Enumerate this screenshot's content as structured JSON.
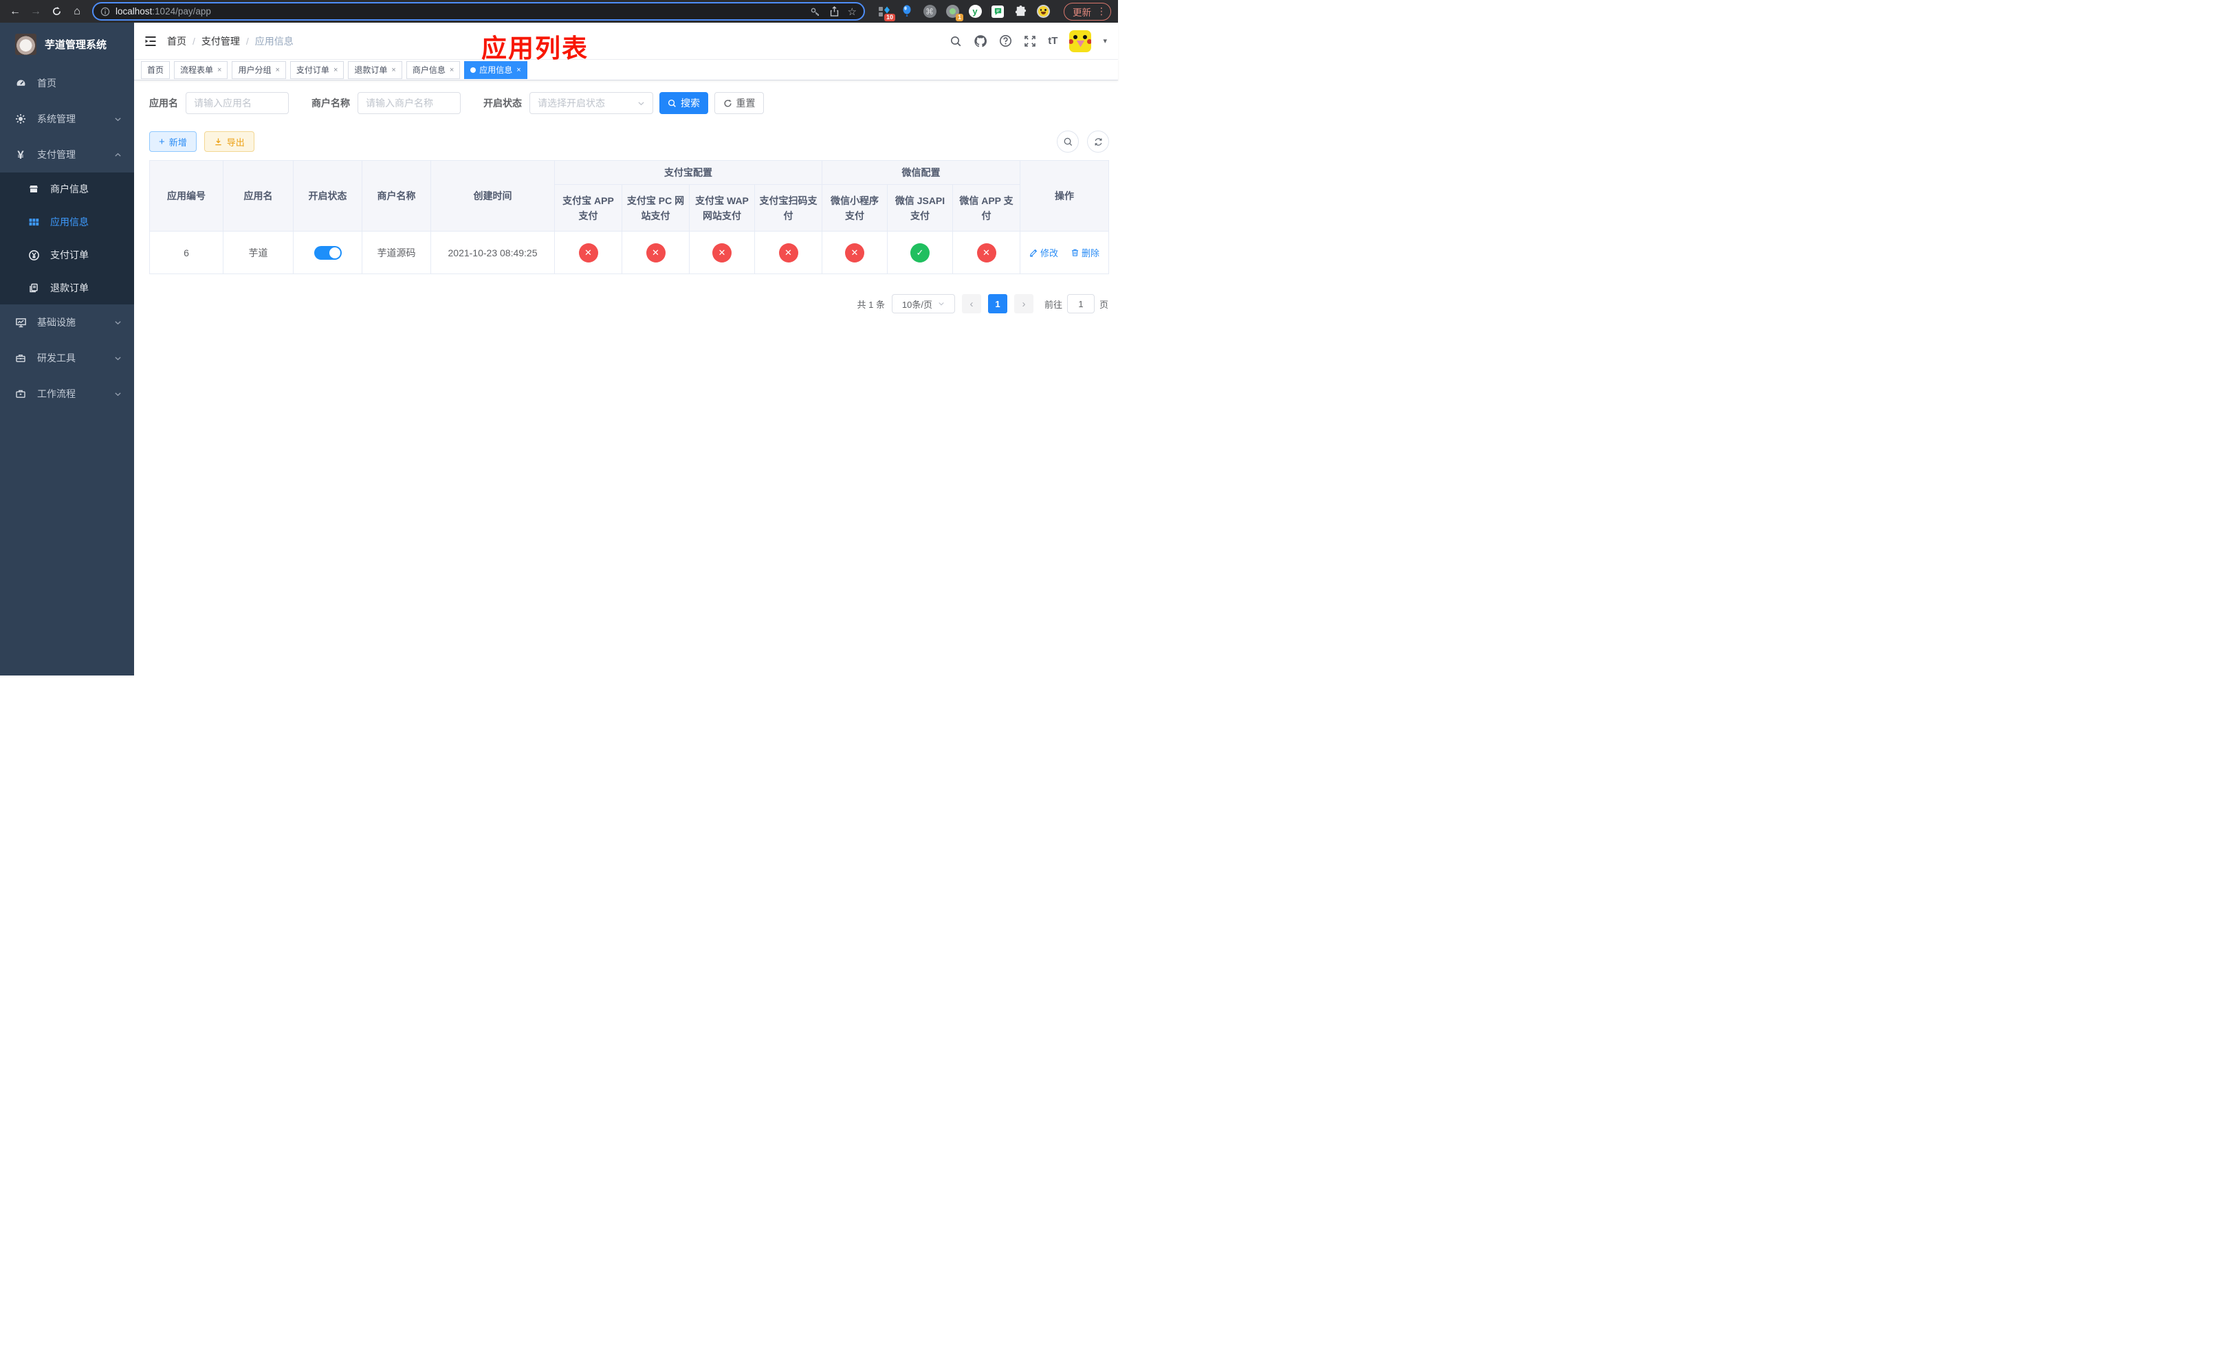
{
  "browser": {
    "url_host": "localhost",
    "url_path": ":1024/pay/app",
    "update_button": "更新",
    "extension_badge_1": "10",
    "extension_badge_2": "1"
  },
  "sidebar": {
    "title": "芋道管理系统",
    "items": [
      {
        "label": "首页"
      },
      {
        "label": "系统管理"
      },
      {
        "label": "支付管理"
      },
      {
        "label": "基础设施"
      },
      {
        "label": "研发工具"
      },
      {
        "label": "工作流程"
      }
    ],
    "payment_submenu": [
      {
        "label": "商户信息"
      },
      {
        "label": "应用信息"
      },
      {
        "label": "支付订单"
      },
      {
        "label": "退款订单"
      }
    ]
  },
  "header": {
    "breadcrumb": [
      "首页",
      "支付管理",
      "应用信息"
    ],
    "annotation": "应用列表"
  },
  "tabs": [
    {
      "label": "首页"
    },
    {
      "label": "流程表单"
    },
    {
      "label": "用户分组"
    },
    {
      "label": "支付订单"
    },
    {
      "label": "退款订单"
    },
    {
      "label": "商户信息"
    },
    {
      "label": "应用信息"
    }
  ],
  "filters": {
    "app_name_label": "应用名",
    "app_name_placeholder": "请输入应用名",
    "merchant_label": "商户名称",
    "merchant_placeholder": "请输入商户名称",
    "status_label": "开启状态",
    "status_placeholder": "请选择开启状态",
    "search_button": "搜索",
    "reset_button": "重置"
  },
  "toolbar": {
    "add_button": "新增",
    "export_button": "导出"
  },
  "table": {
    "columns": [
      "应用编号",
      "应用名",
      "开启状态",
      "商户名称",
      "创建时间"
    ],
    "group_alipay": "支付宝配置",
    "group_wechat": "微信配置",
    "alipay_columns": [
      "支付宝 APP 支付",
      "支付宝 PC 网站支付",
      "支付宝 WAP 网站支付",
      "支付宝扫码支付"
    ],
    "wechat_columns": [
      "微信小程序支付",
      "微信 JSAPI 支付",
      "微信 APP 支付"
    ],
    "actions_column": "操作",
    "row": {
      "id": "6",
      "app_name": "芋道",
      "enabled": true,
      "merchant_name": "芋道源码",
      "created_at": "2021-10-23 08:49:25",
      "payment_status": [
        false,
        false,
        false,
        false,
        false,
        true,
        false
      ],
      "edit_action": "修改",
      "delete_action": "删除"
    }
  },
  "pagination": {
    "total": "共 1 条",
    "page_size": "10条/页",
    "current_page": "1",
    "goto_label": "前往",
    "goto_value": "1",
    "page_unit": "页"
  },
  "icons": {
    "check": "✓",
    "cross": "✕",
    "close": "×",
    "yen": "¥",
    "back": "←",
    "forward": "→",
    "home": "⌂",
    "star": "☆",
    "command": "⌘",
    "dots_vertical": "⋮",
    "prev": "‹",
    "next": "›",
    "caret": "▾",
    "font_size": "tT",
    "plus": "+",
    "y_logo": "y"
  },
  "colors": {
    "primary": "#2186fa",
    "menu_active": "#3e9bff",
    "success": "#20bf5f",
    "danger": "#f34d4d",
    "warning": "#eca116",
    "sidebar_bg": "#304156",
    "submenu_bg": "#1f2d3d",
    "annotation_red": "#f81703"
  }
}
